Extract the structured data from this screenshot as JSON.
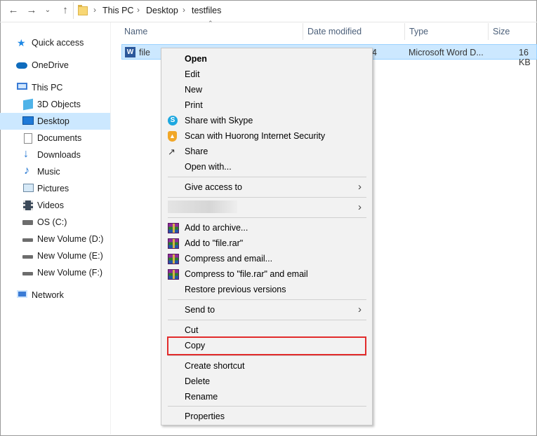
{
  "breadcrumb": [
    "This PC",
    "Desktop",
    "testfiles"
  ],
  "nav": {
    "items": [
      {
        "label": "Quick access",
        "icon": "star-icon"
      },
      {
        "label": "OneDrive",
        "icon": "cloud-icon"
      },
      {
        "label": "This PC",
        "icon": "computer-icon"
      },
      {
        "label": "3D Objects",
        "icon": "cube-icon"
      },
      {
        "label": "Desktop",
        "icon": "desktop-icon"
      },
      {
        "label": "Documents",
        "icon": "documents-icon"
      },
      {
        "label": "Downloads",
        "icon": "download-arrow-icon"
      },
      {
        "label": "Music",
        "icon": "music-note-icon"
      },
      {
        "label": "Pictures",
        "icon": "pictures-icon"
      },
      {
        "label": "Videos",
        "icon": "film-icon"
      },
      {
        "label": "OS (C:)",
        "icon": "drive-icon"
      },
      {
        "label": "New Volume (D:)",
        "icon": "drive-icon"
      },
      {
        "label": "New Volume (E:)",
        "icon": "drive-icon"
      },
      {
        "label": "New Volume (F:)",
        "icon": "drive-icon"
      },
      {
        "label": "Network",
        "icon": "network-icon"
      }
    ]
  },
  "columns": {
    "name": "Name",
    "date": "Date modified",
    "type": "Type",
    "size": "Size"
  },
  "file": {
    "name": "file",
    "type": "Microsoft Word D...",
    "size": "16 KB",
    "date_fragment": "4"
  },
  "menu": {
    "items": [
      {
        "label": "Open",
        "bold": true
      },
      {
        "label": "Edit"
      },
      {
        "label": "New"
      },
      {
        "label": "Print"
      },
      {
        "label": "Share with Skype",
        "icon": "skype-icon"
      },
      {
        "label": "Scan with Huorong Internet Security",
        "icon": "huorong-shield-icon"
      },
      {
        "label": "Share",
        "icon": "share-icon"
      },
      {
        "label": "Open with..."
      },
      {
        "label": "Give access to",
        "submenu": true
      },
      {
        "label": "Add to archive...",
        "icon": "winrar-icon"
      },
      {
        "label": "Add to \"file.rar\"",
        "icon": "winrar-icon"
      },
      {
        "label": "Compress and email...",
        "icon": "winrar-icon"
      },
      {
        "label": "Compress to \"file.rar\" and email",
        "icon": "winrar-icon"
      },
      {
        "label": "Restore previous versions"
      },
      {
        "label": "Send to",
        "submenu": true
      },
      {
        "label": "Cut"
      },
      {
        "label": "Copy",
        "highlighted": true
      },
      {
        "label": "Create shortcut"
      },
      {
        "label": "Delete"
      },
      {
        "label": "Rename"
      },
      {
        "label": "Properties"
      }
    ]
  },
  "colors": {
    "selection": "#cce8ff",
    "highlight_box": "#e22b2b",
    "menu_bg": "#f2f2f2"
  }
}
